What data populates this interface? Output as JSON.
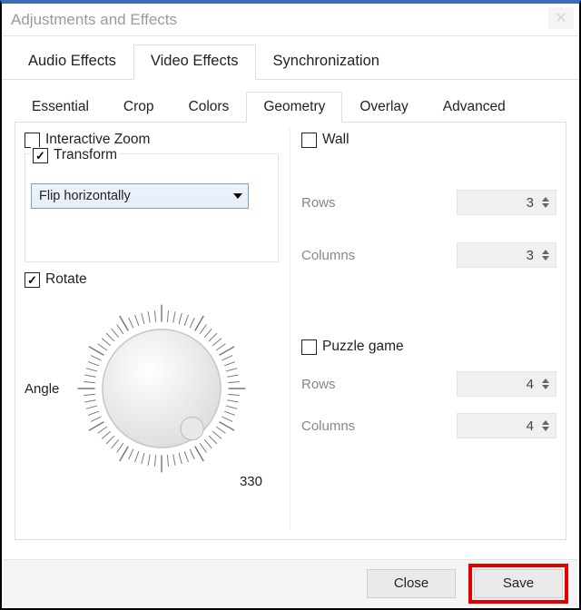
{
  "window": {
    "title": "Adjustments and Effects"
  },
  "mainTabs": {
    "items": [
      "Audio Effects",
      "Video Effects",
      "Synchronization"
    ],
    "active": "Video Effects"
  },
  "subTabs": {
    "items": [
      "Essential",
      "Crop",
      "Colors",
      "Geometry",
      "Overlay",
      "Advanced"
    ],
    "active": "Geometry"
  },
  "geometry": {
    "interactive_zoom": {
      "label": "Interactive Zoom",
      "checked": false
    },
    "transform": {
      "label": "Transform",
      "checked": true,
      "mode": "Flip horizontally"
    },
    "rotate": {
      "label": "Rotate",
      "checked": true,
      "angle_label": "Angle",
      "angle_value": 330
    },
    "wall": {
      "label": "Wall",
      "checked": false,
      "rows_label": "Rows",
      "rows_value": 3,
      "cols_label": "Columns",
      "cols_value": 3
    },
    "puzzle": {
      "label": "Puzzle game",
      "checked": false,
      "rows_label": "Rows",
      "rows_value": 4,
      "cols_label": "Columns",
      "cols_value": 4
    }
  },
  "footer": {
    "close": "Close",
    "save": "Save"
  }
}
